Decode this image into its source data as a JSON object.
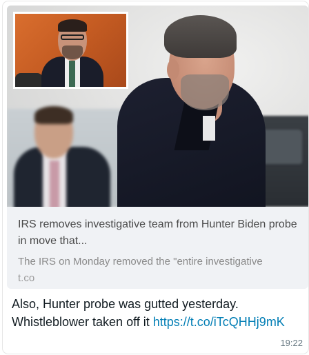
{
  "message": {
    "preview": {
      "title": "IRS removes investigative team from Hunter Biden probe in move that...",
      "description": "The IRS on Monday removed the \"entire investigative",
      "domain": "t.co"
    },
    "text_line1": "Also, Hunter probe was gutted yesterday.",
    "text_line2_prefix": "Whistleblower taken off it ",
    "link": "https://t.co/iTcQHHj9mK",
    "time": "19:22"
  },
  "colors": {
    "link": "#027eb5",
    "bubble": "#ffffff",
    "preview_bg": "#f0f2f5"
  }
}
